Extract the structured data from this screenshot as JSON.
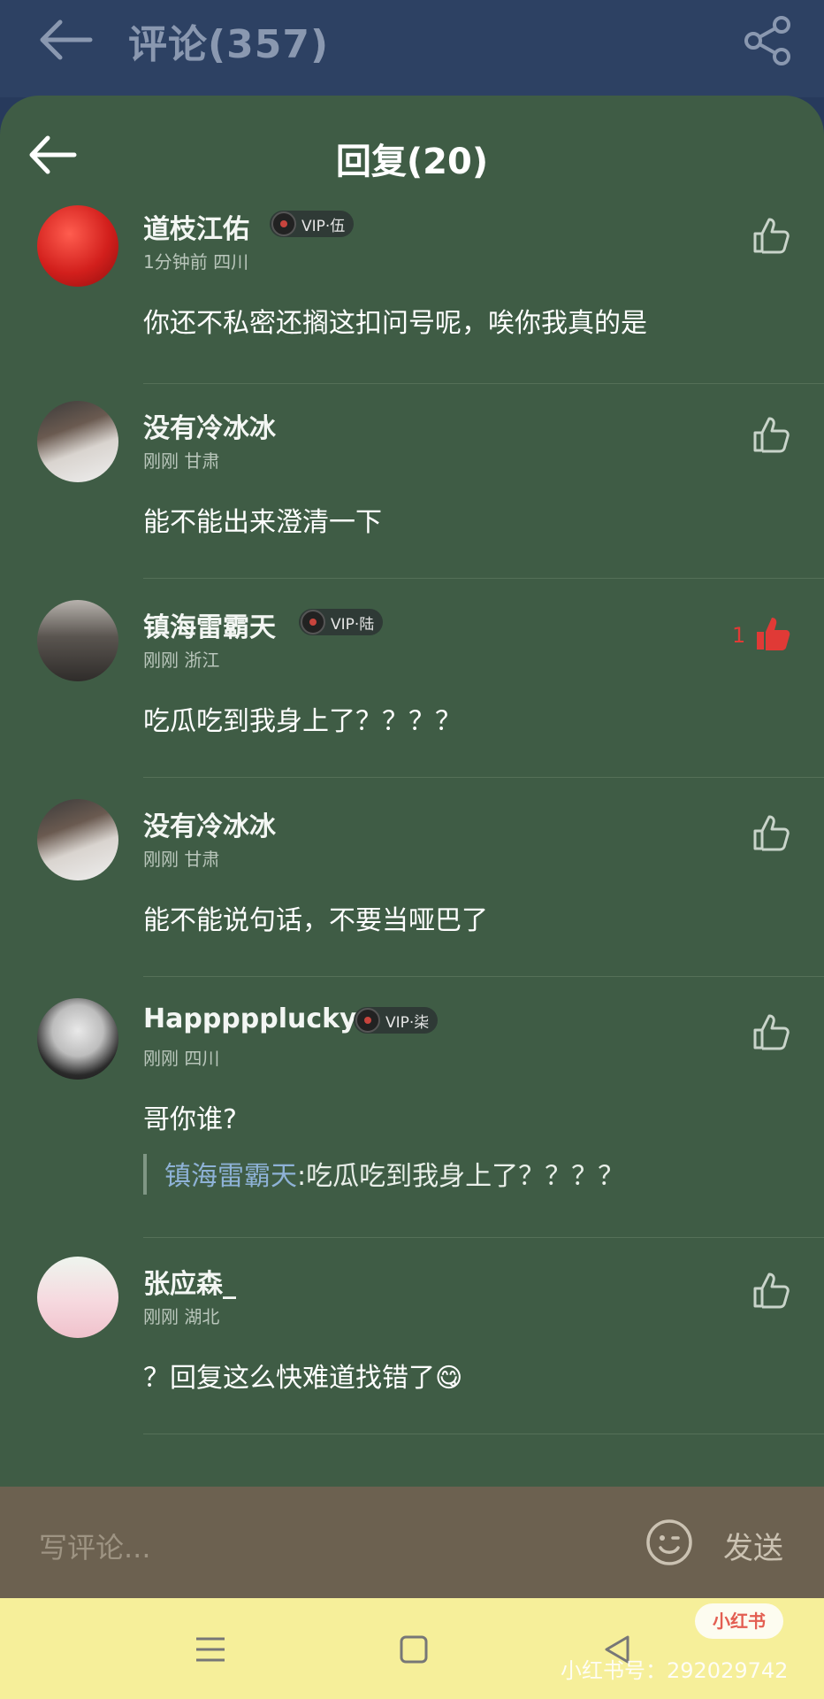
{
  "header": {
    "title": "评论(357)"
  },
  "sheet": {
    "title": "回复(20)"
  },
  "comments": [
    {
      "name": "道枝江佑",
      "vip": "VIP·伍",
      "meta": "1分钟前 四川",
      "text": "你还不私密还搁这扣问号呢，唉你我真的是",
      "likes": ""
    },
    {
      "name": "没有冷冰冰",
      "vip": "",
      "meta": "刚刚 甘肃",
      "text": "能不能出来澄清一下",
      "likes": ""
    },
    {
      "name": "镇海雷霸天",
      "vip": "VIP·陆",
      "meta": "刚刚 浙江",
      "text": "吃瓜吃到我身上了？？？？",
      "likes": "1"
    },
    {
      "name": "没有冷冰冰",
      "vip": "",
      "meta": "刚刚 甘肃",
      "text": "能不能说句话，不要当哑巴了",
      "likes": ""
    },
    {
      "name": "Happppplucky",
      "vip": "VIP·柒",
      "meta": "刚刚 四川",
      "text": "哥你谁?",
      "likes": "",
      "quote": {
        "name": "镇海雷霸天",
        "text": ":吃瓜吃到我身上了？？？？"
      }
    },
    {
      "name": "张应森_",
      "vip": "",
      "meta": "刚刚 湖北",
      "text": "？回复这么快难道找错了😋",
      "likes": ""
    }
  ],
  "input": {
    "placeholder": "写评论...",
    "send_label": "发送"
  },
  "watermark": {
    "logo": "小红书",
    "id": "小红书号：292029742"
  },
  "colors": {
    "sheet": "#3f5c45",
    "topbar": "#2d4163",
    "like_active": "#e03a36",
    "navbar": "#f6ef9a"
  }
}
